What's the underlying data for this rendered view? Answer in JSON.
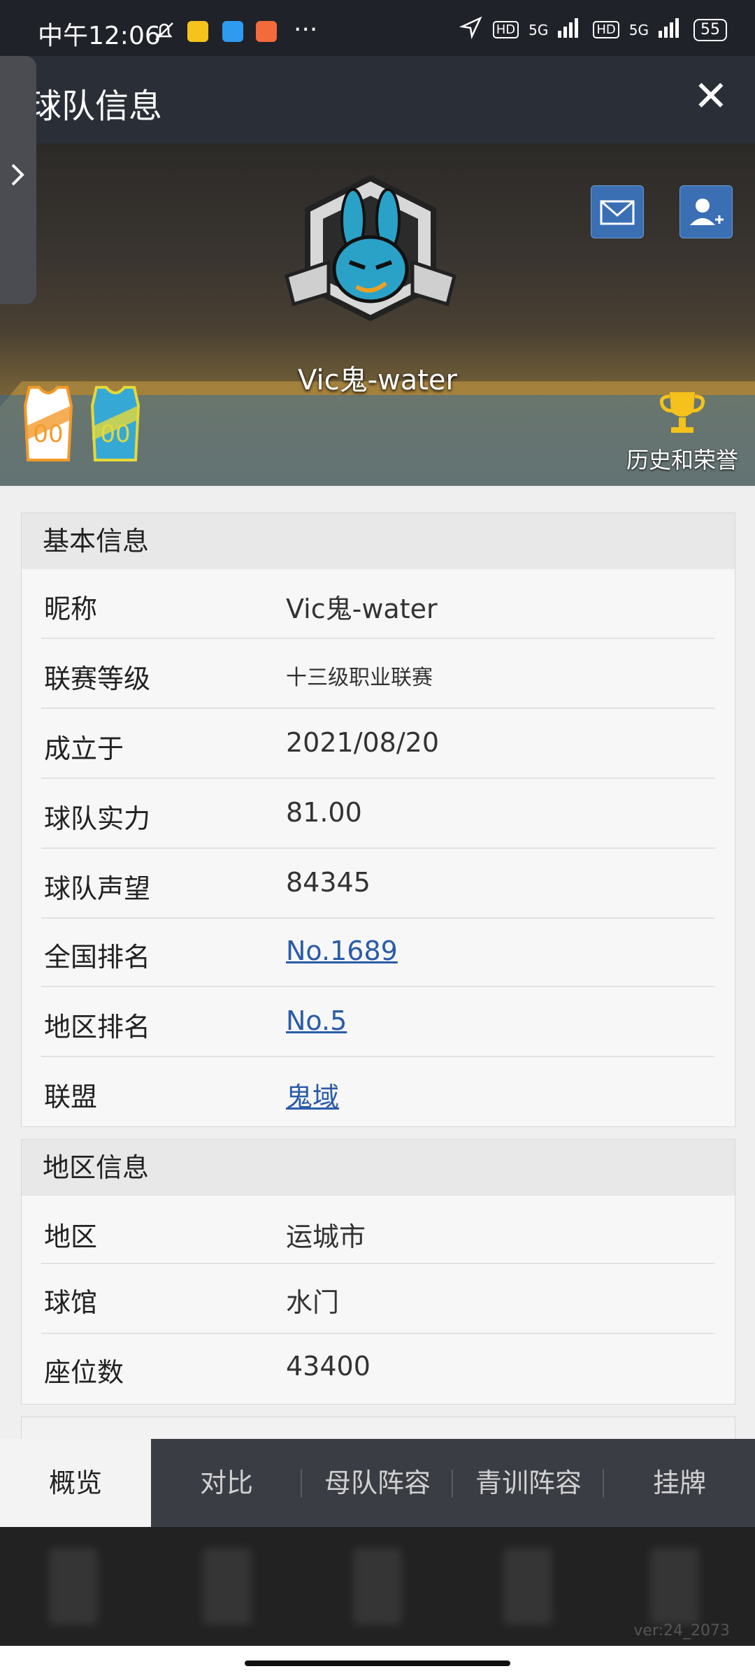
{
  "status_bar": {
    "time": "中午12:06",
    "battery": "55",
    "signal1": "5G",
    "signal2": "5G",
    "dots": "···"
  },
  "header": {
    "title": "球队信息",
    "close": "✕"
  },
  "banner": {
    "team_name": "Vic鬼-water",
    "jersey_number": "00",
    "honors_label": "历史和荣誉"
  },
  "basic_info": {
    "title": "基本信息",
    "rows": [
      {
        "label": "昵称",
        "value": "Vic鬼-water"
      },
      {
        "label": "联赛等级",
        "value": "十三级职业联赛"
      },
      {
        "label": "成立于",
        "value": "2021/08/20"
      },
      {
        "label": "球队实力",
        "value": "81.00"
      },
      {
        "label": "球队声望",
        "value": "84345"
      },
      {
        "label": "全国排名",
        "value": "No.1689"
      },
      {
        "label": "地区排名",
        "value": "No.5"
      },
      {
        "label": "联盟",
        "value": "鬼域"
      }
    ]
  },
  "region_info": {
    "title": "地区信息",
    "rows": [
      {
        "label": "地区",
        "value": "运城市"
      },
      {
        "label": "球馆",
        "value": "水门"
      },
      {
        "label": "座位数",
        "value": "43400"
      }
    ]
  },
  "tabs": [
    "概览",
    "对比",
    "母队阵容",
    "青训阵容",
    "挂牌"
  ],
  "version": "ver:24_2073",
  "colors": {
    "link": "#2a5ca8",
    "header_bg": "#2a2e36",
    "tab_bg": "#3a3d44",
    "button_blue": "#3a6fb4"
  }
}
